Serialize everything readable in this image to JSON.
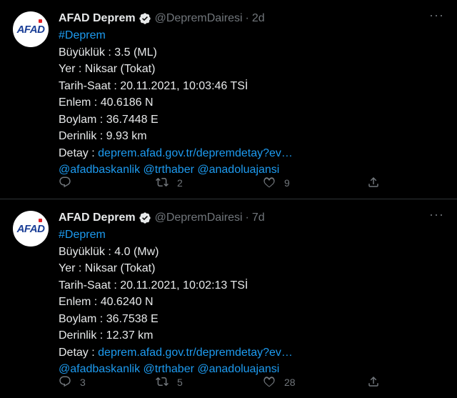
{
  "tweets": [
    {
      "avatar_text": "AFAD",
      "name": "AFAD Deprem",
      "handle": "@DepremDairesi",
      "separator": "·",
      "time": "2d",
      "more": "···",
      "hashtag": "#Deprem",
      "lines": [
        "Büyüklük : 3.5 (ML)",
        "Yer : Niksar (Tokat)",
        "Tarih-Saat : 20.11.2021, 10:03:46 TSİ",
        "Enlem : 40.6186 N",
        "Boylam : 36.7448 E",
        "Derinlik : 9.93 km"
      ],
      "detail_label": "Detay : ",
      "detail_link": "deprem.afad.gov.tr/depremdetay?ev…",
      "mentions": "@afadbaskanlik @trthaber @anadoluajansi",
      "reply_count": "",
      "retweet_count": "2",
      "like_count": "9"
    },
    {
      "avatar_text": "AFAD",
      "name": "AFAD Deprem",
      "handle": "@DepremDairesi",
      "separator": "·",
      "time": "7d",
      "more": "···",
      "hashtag": "#Deprem",
      "lines": [
        "Büyüklük : 4.0 (Mw)",
        "Yer : Niksar (Tokat)",
        "Tarih-Saat : 20.11.2021, 10:02:13 TSİ",
        "Enlem : 40.6240 N",
        "Boylam : 36.7538 E",
        "Derinlik : 12.37 km"
      ],
      "detail_label": "Detay : ",
      "detail_link": "deprem.afad.gov.tr/depremdetay?ev…",
      "mentions": "@afadbaskanlik @trthaber @anadoluajansi",
      "reply_count": "3",
      "retweet_count": "5",
      "like_count": "28"
    }
  ],
  "colors": {
    "background": "#000000",
    "text": "#e7e9ea",
    "muted": "#71767b",
    "link": "#1d9bf0",
    "verified": "#e7e9ea",
    "divider": "#2f3336",
    "logo_blue": "#1a3e96",
    "logo_red": "#e32126"
  },
  "icons": [
    "verified-badge-icon",
    "more-icon",
    "reply-icon",
    "retweet-icon",
    "like-icon",
    "share-icon"
  ]
}
